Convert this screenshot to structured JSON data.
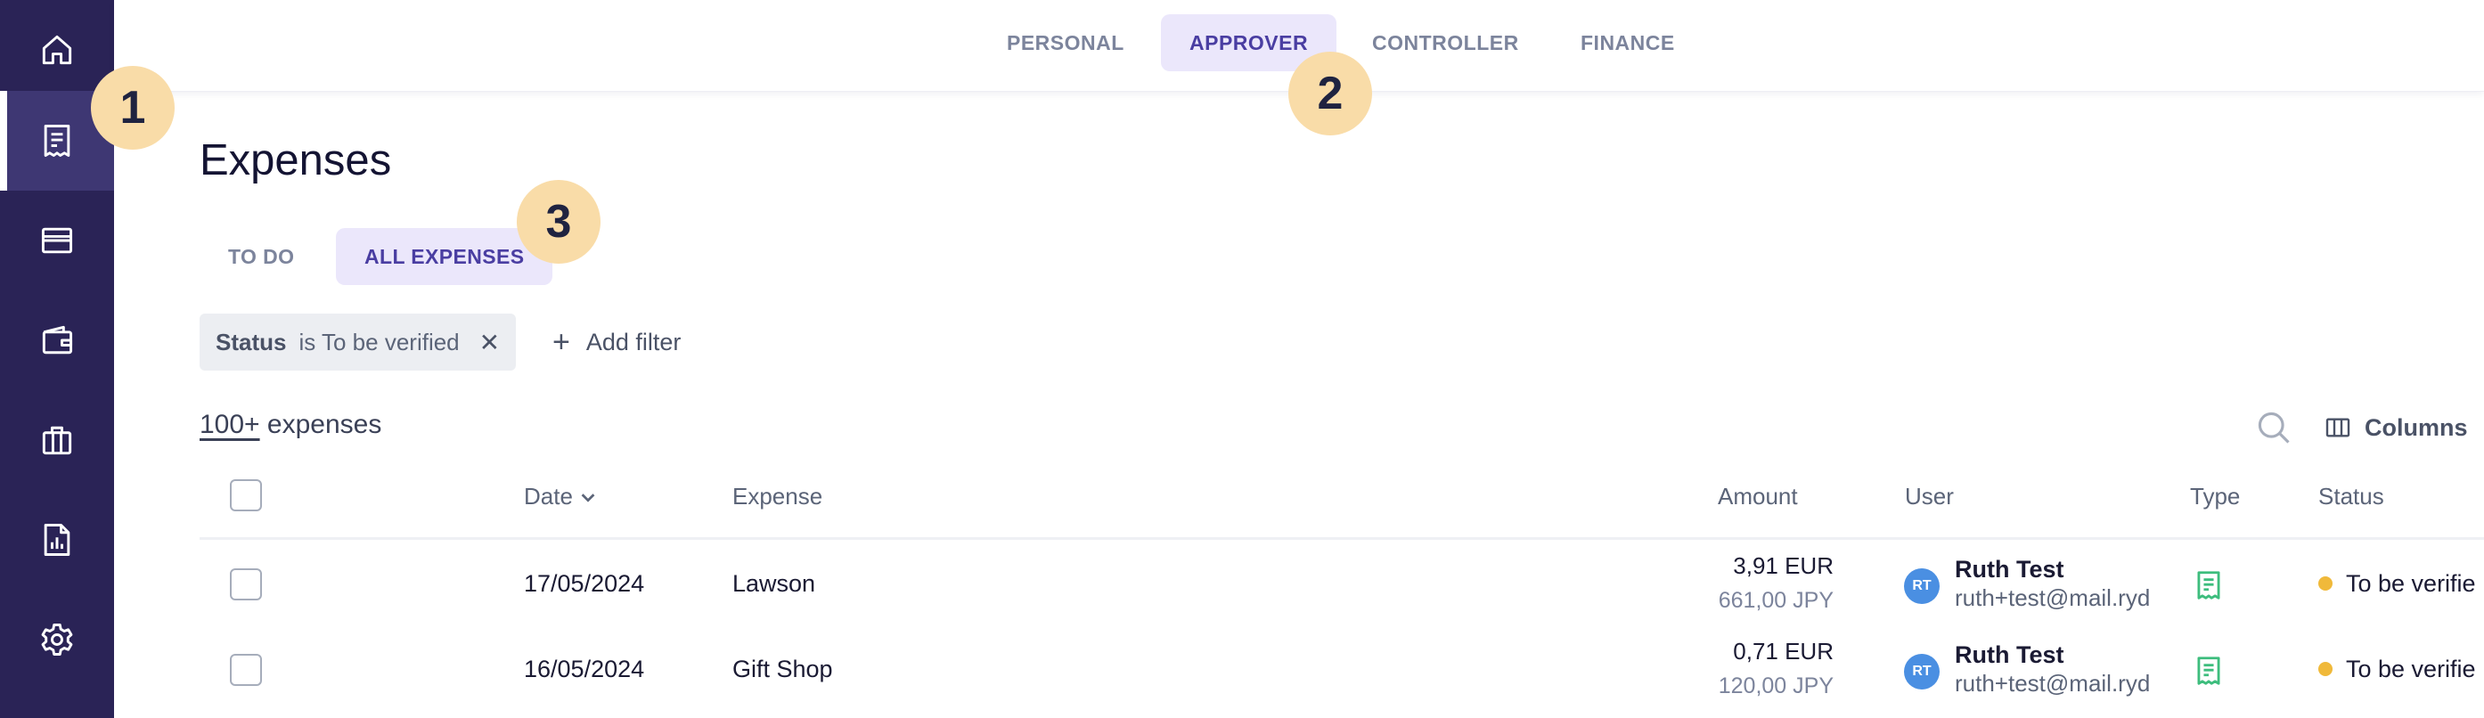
{
  "sidebar": {
    "items": [
      {
        "icon": "home-icon",
        "active": false
      },
      {
        "icon": "receipt-icon",
        "active": true
      },
      {
        "icon": "card-icon",
        "active": false
      },
      {
        "icon": "wallet-icon",
        "active": false
      },
      {
        "icon": "briefcase-icon",
        "active": false
      },
      {
        "icon": "report-icon",
        "active": false
      },
      {
        "icon": "gear-icon",
        "active": false
      }
    ]
  },
  "header": {
    "role_tabs": [
      {
        "label": "PERSONAL",
        "active": false
      },
      {
        "label": "APPROVER",
        "active": true
      },
      {
        "label": "CONTROLLER",
        "active": false
      },
      {
        "label": "FINANCE",
        "active": false
      }
    ]
  },
  "main": {
    "title": "Expenses",
    "view_tabs": [
      {
        "label": "TO DO",
        "active": false
      },
      {
        "label": "ALL EXPENSES",
        "active": true
      }
    ],
    "filter": {
      "key": "Status",
      "value": "is To be verified",
      "remove_symbol": "✕"
    },
    "add_filter_label": "Add filter",
    "count": {
      "value": "100+",
      "label": "expenses"
    },
    "columns_label": "Columns"
  },
  "table": {
    "headers": {
      "date": "Date",
      "expense": "Expense",
      "amount": "Amount",
      "user": "User",
      "type": "Type",
      "status": "Status"
    },
    "rows": [
      {
        "date": "17/05/2024",
        "expense": "Lawson",
        "amount": "3,91 EUR",
        "amount_original": "661,00 JPY",
        "user_initials": "RT",
        "user_name": "Ruth Test",
        "user_email": "ruth+test@mail.ryd",
        "type_icon": "receipt-icon",
        "status": "To be verifie"
      },
      {
        "date": "16/05/2024",
        "expense": "Gift Shop",
        "amount": "0,71 EUR",
        "amount_original": "120,00 JPY",
        "user_initials": "RT",
        "user_name": "Ruth Test",
        "user_email": "ruth+test@mail.ryd",
        "type_icon": "receipt-icon",
        "status": "To be verifie"
      }
    ]
  },
  "callouts": [
    "1",
    "2",
    "3"
  ],
  "colors": {
    "sidebar_bg": "#2a2356",
    "accent": "#4a3ea2",
    "tab_active_bg": "#ebe7fb",
    "callout_bg": "#f9dca8",
    "avatar_bg": "#4a8fe2",
    "type_icon": "#3dbd7d",
    "status_dot": "#f0b93a"
  }
}
